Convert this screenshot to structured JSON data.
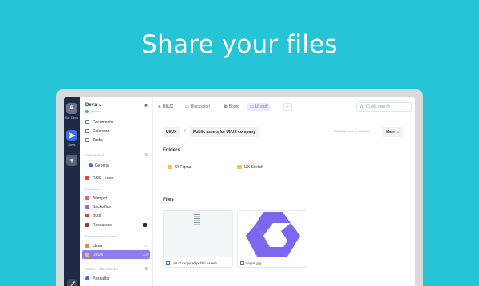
{
  "headline": "Share your files",
  "rail": {
    "workspaces": [
      {
        "initial": "B",
        "label": "Biz Devs",
        "color": "#6c7487"
      },
      {
        "initial": "",
        "label": "Devs",
        "color": "#3a6fe0"
      },
      {
        "initial": "+",
        "label": "",
        "color": "#5a6274"
      }
    ]
  },
  "sidebar": {
    "workspace_name": "Devs",
    "user_status": "@devs",
    "nav": [
      "Documents",
      "Calendar",
      "Tasks"
    ],
    "channels_header": "CHANNELS",
    "channels": [
      "General",
      "RSS · news"
    ],
    "more_header": "Web Dev",
    "projects": [
      "Alumjert",
      "Backoffice",
      "Bugs",
      "Resources"
    ],
    "secondary_header": "Secondary Projects",
    "secondary": [
      "Ideas",
      "UI/UX"
    ],
    "dm_header": "DIRECT MESSAGES",
    "dm_first": "Pascalito"
  },
  "tabs": {
    "channel": "UI/UX",
    "items": [
      "Discussion",
      "Board",
      "UI stuff"
    ],
    "more": "···"
  },
  "search": {
    "placeholder": "Quick search"
  },
  "breadcrumb": {
    "root": "UI/UX",
    "sep": "›",
    "current": "Public assets for UI/UX company",
    "info": "UMA folder and on this folder",
    "more": "More ⌄"
  },
  "folders": {
    "title": "Folders",
    "items": [
      "UI Figma",
      "UX Sketch"
    ]
  },
  "files": {
    "title": "Files",
    "items": [
      "List of required public assets",
      "Logos.jpg"
    ]
  },
  "fab": "+",
  "colors": {
    "background": "#25c4d6",
    "accent": "#7b68ee",
    "rail": "#1e2a44"
  }
}
